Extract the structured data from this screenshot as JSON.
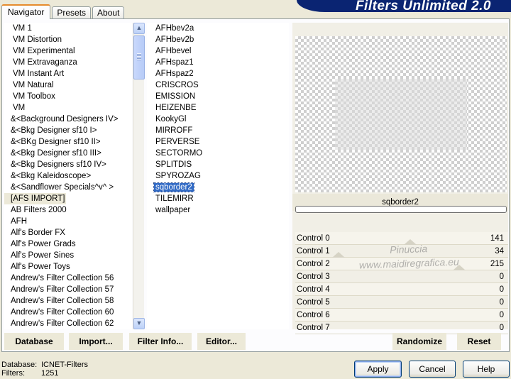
{
  "window": {
    "title": "Filters Unlimited 2.0"
  },
  "tabs": [
    {
      "label": "Navigator",
      "active": true
    },
    {
      "label": "Presets",
      "active": false
    },
    {
      "label": "About",
      "active": false
    }
  ],
  "categories": [
    "VM 1",
    "VM Distortion",
    "VM Experimental",
    "VM Extravaganza",
    "VM Instant Art",
    "VM Natural",
    "VM Toolbox",
    "VM",
    "&<Background Designers IV>",
    "&<Bkg Designer sf10 I>",
    "&<BKg Designer sf10 II>",
    "&<Bkg Designer sf10 III>",
    "&<Bkg Designers sf10 IV>",
    "&<Bkg Kaleidoscope>",
    "&<Sandflower Specials^v^ >",
    "[AFS IMPORT]",
    "AB Filters 2000",
    "AFH",
    "Alf's Border FX",
    "Alf's Power Grads",
    "Alf's Power Sines",
    "Alf's Power Toys",
    "Andrew's Filter Collection 56",
    "Andrew's Filter Collection 57",
    "Andrew's Filter Collection 58",
    "Andrew's Filter Collection 60",
    "Andrew's Filter Collection 62"
  ],
  "selected_category": "[AFS IMPORT]",
  "filters": [
    "AFHbev2a",
    "AFHbev2b",
    "AFHbevel",
    "AFHspaz1",
    "AFHspaz2",
    "CRISCROS",
    "EMISSION",
    "HEIZENBE",
    "KookyGl",
    "MIRROFF",
    "PERVERSE",
    "SECTORMO",
    "SPLITDIS",
    "SPYROZAG",
    "sqborder2",
    "TILEMIRR",
    "wallpaper"
  ],
  "selected_filter": "sqborder2",
  "preview": {
    "filter_name": "sqborder2"
  },
  "controls": [
    {
      "label": "Control 0",
      "value": "141"
    },
    {
      "label": "Control 1",
      "value": "34"
    },
    {
      "label": "Control 2",
      "value": "215"
    },
    {
      "label": "Control 3",
      "value": "0"
    },
    {
      "label": "Control 4",
      "value": "0"
    },
    {
      "label": "Control 5",
      "value": "0"
    },
    {
      "label": "Control 6",
      "value": "0"
    },
    {
      "label": "Control 7",
      "value": "0"
    }
  ],
  "watermark": {
    "line1": "Pinuccia",
    "line2": "www.maidiregrafica.eu"
  },
  "toolbar": {
    "database": "Database",
    "import": "Import...",
    "filter_info": "Filter Info...",
    "editor": "Editor...",
    "randomize": "Randomize",
    "reset": "Reset"
  },
  "status": {
    "database_label": "Database:",
    "database_value": "ICNET-Filters",
    "filters_label": "Filters:",
    "filters_value": "1251"
  },
  "buttons": {
    "apply": "Apply",
    "cancel": "Cancel",
    "help": "Help"
  },
  "icons": {
    "scroll_up": "chevron-up-icon",
    "scroll_down": "chevron-down-icon"
  },
  "colors": {
    "accent": "#0a2472",
    "selection": "#316ac5",
    "tab_highlight": "#e68b2c",
    "background": "#ece9d8"
  }
}
